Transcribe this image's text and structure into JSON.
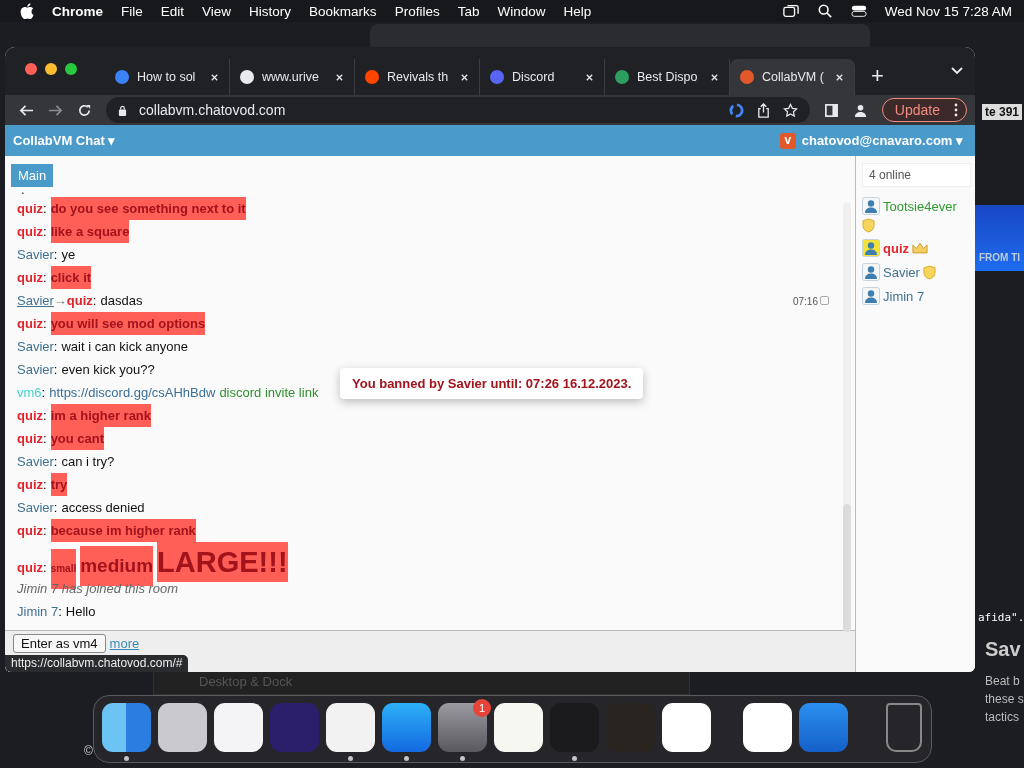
{
  "menu_bar": {
    "app": "Chrome",
    "items": [
      "File",
      "Edit",
      "View",
      "History",
      "Bookmarks",
      "Profiles",
      "Tab",
      "Window",
      "Help"
    ],
    "clock": "Wed Nov 15  7:28 AM"
  },
  "desktop": {
    "fragments": [
      {
        "kind": "count",
        "text": "te 391"
      },
      {
        "kind": "banner",
        "text": "FROM TI"
      },
      {
        "kind": "code",
        "text": "afida\"."
      },
      {
        "kind": "heading",
        "text": "Sav"
      },
      {
        "kind": "para",
        "text": "Beat b"
      },
      {
        "kind": "para",
        "text": "these s"
      },
      {
        "kind": "para",
        "text": "tactics"
      }
    ],
    "back_window": {
      "title": "Desktop & Dock"
    },
    "copyright": "©"
  },
  "browser": {
    "tabs": [
      {
        "title": "How to sol",
        "kind": "bracket",
        "selected": false
      },
      {
        "title": "www.urive",
        "kind": "globe",
        "selected": false
      },
      {
        "title": "Revivals th",
        "kind": "alien",
        "selected": false
      },
      {
        "title": "Discord",
        "kind": "controller",
        "selected": false
      },
      {
        "title": "Best Dispo",
        "kind": "bubble",
        "selected": false
      },
      {
        "title": "CollabVM (",
        "kind": "v",
        "selected": true
      }
    ],
    "new_tab": "+",
    "url": "collabvm.chatovod.com",
    "update": "Update",
    "status_url": "https://collabvm.chatovod.com/#"
  },
  "chat": {
    "title": "CollabVM Chat",
    "title_caret": "▾",
    "account": "chatovod@cnavaro.com",
    "account_caret": "▾",
    "room_tabs": [
      {
        "label": "Main",
        "selected": true
      }
    ],
    "messages": [
      {
        "kind": "fragment",
        "text": "."
      },
      {
        "kind": "bold",
        "sender": "quiz",
        "color": "#e0242c",
        "separator": ":",
        "text": "do you see something next to it"
      },
      {
        "kind": "bold",
        "sender": "quiz",
        "color": "#e0242c",
        "separator": ":",
        "text": "like a square"
      },
      {
        "kind": "plain",
        "sender": "Savier",
        "color": "#3f7191",
        "separator": ":",
        "text": "ye"
      },
      {
        "kind": "bold",
        "sender": "quiz",
        "color": "#e0242c",
        "separator": ":",
        "text": "click it"
      },
      {
        "kind": "private",
        "sender": "Savier",
        "color": "#3f7191",
        "arrow": "→",
        "to": {
          "name": "quiz",
          "color": "#e0242c"
        },
        "separator": ":",
        "text": "dasdas",
        "time": "07:16"
      },
      {
        "kind": "bold",
        "sender": "quiz",
        "color": "#e0242c",
        "separator": ":",
        "text": "you will see mod options"
      },
      {
        "kind": "plain",
        "sender": "Savier",
        "color": "#3f7191",
        "separator": ":",
        "text": "wait i can kick anyone"
      },
      {
        "kind": "plain",
        "sender": "Savier",
        "color": "#3f7191",
        "separator": ":",
        "text": "even kick you??"
      },
      {
        "kind": "link",
        "sender": "vm6",
        "color": "#43d3d3",
        "separator": ":",
        "text": "https://discord.gg/csAHhBdw",
        "note": "discord invite link"
      },
      {
        "kind": "bold",
        "sender": "quiz",
        "color": "#e0242c",
        "separator": ":",
        "text": "im a higher rank"
      },
      {
        "kind": "bold",
        "sender": "quiz",
        "color": "#e0242c",
        "separator": ":",
        "text": "you cant"
      },
      {
        "kind": "plain",
        "sender": "Savier",
        "color": "#3f7191",
        "separator": ":",
        "text": "can i try?"
      },
      {
        "kind": "bold",
        "sender": "quiz",
        "color": "#e0242c",
        "separator": ":",
        "text": "try"
      },
      {
        "kind": "plain",
        "sender": "Savier",
        "color": "#3f7191",
        "separator": ":",
        "text": "access denied"
      },
      {
        "kind": "bold",
        "sender": "quiz",
        "color": "#e0242c",
        "separator": ":",
        "text": "because im higher rank"
      },
      {
        "kind": "sizes",
        "sender": "quiz",
        "color": "#e0242c",
        "separator": ":",
        "parts": [
          {
            "kind": "small",
            "text": "small"
          },
          {
            "kind": "medium",
            "text": "medium"
          },
          {
            "kind": "large",
            "text": "LARGE!!!"
          }
        ]
      },
      {
        "kind": "system",
        "text": "Jimin 7 has joined this room"
      },
      {
        "kind": "plain",
        "sender": "Jimin 7",
        "color": "#3f7191",
        "separator": ":",
        "text": "Hello"
      }
    ],
    "enter_button": "Enter as vm4",
    "more_link": "more",
    "toast": "You banned by Savier until: 07:26 16.12.2023.",
    "online": "4 online",
    "users": [
      {
        "name": "Tootsie4ever",
        "color": "#2d9a2d",
        "badge": {
          "kind": "shield"
        },
        "self": false
      },
      {
        "name": "quiz",
        "color": "#e0242c",
        "badge": {
          "kind": "crown"
        },
        "self": true
      },
      {
        "name": "Savier",
        "color": "#3f7191",
        "badge": {
          "kind": "shield"
        },
        "self": false
      },
      {
        "name": "Jimin 7",
        "color": "#3f7191",
        "self": false
      }
    ]
  },
  "dock": {
    "apps": [
      {
        "kind": "finder",
        "running": true
      },
      {
        "kind": "launchpad",
        "running": false
      },
      {
        "kind": "safari",
        "running": false
      },
      {
        "kind": "firefox",
        "running": false
      },
      {
        "kind": "chrome",
        "running": true
      },
      {
        "kind": "store",
        "running": true
      },
      {
        "kind": "settings",
        "running": true,
        "badge": "1"
      },
      {
        "kind": "notes",
        "running": false
      },
      {
        "kind": "terminal",
        "running": true
      },
      {
        "kind": "guitar",
        "running": false
      },
      {
        "kind": "code",
        "running": false
      },
      {
        "kind": "separator"
      },
      {
        "kind": "studio",
        "running": false
      },
      {
        "kind": "weather",
        "running": false
      },
      {
        "kind": "separator"
      },
      {
        "kind": "trash",
        "running": false
      }
    ]
  }
}
